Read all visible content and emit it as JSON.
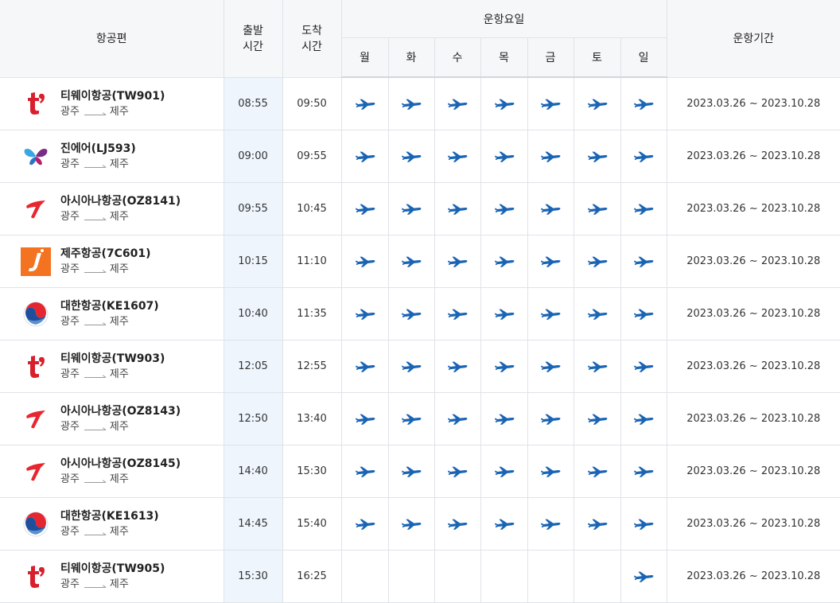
{
  "header": {
    "flight": "항공편",
    "depart_line1": "출발",
    "depart_line2": "시간",
    "arrive_line1": "도착",
    "arrive_line2": "시간",
    "days_group": "운항요일",
    "days": [
      "월",
      "화",
      "수",
      "목",
      "금",
      "토",
      "일"
    ],
    "period": "운항기간"
  },
  "colors": {
    "plane": "#1a64b4",
    "dep_col_bg": "#eef5fd"
  },
  "rows": [
    {
      "airline": "tway",
      "logo_icon": "tway-logo-icon",
      "name": "티웨이항공(TW901)",
      "from": "광주",
      "to": "제주",
      "dep": "08:55",
      "arr": "09:50",
      "days": [
        true,
        true,
        true,
        true,
        true,
        true,
        true
      ],
      "period": "2023.03.26 ~ 2023.10.28"
    },
    {
      "airline": "jinair",
      "logo_icon": "jinair-logo-icon",
      "name": "진에어(LJ593)",
      "from": "광주",
      "to": "제주",
      "dep": "09:00",
      "arr": "09:55",
      "days": [
        true,
        true,
        true,
        true,
        true,
        true,
        true
      ],
      "period": "2023.03.26 ~ 2023.10.28"
    },
    {
      "airline": "asiana",
      "logo_icon": "asiana-logo-icon",
      "name": "아시아나항공(OZ8141)",
      "from": "광주",
      "to": "제주",
      "dep": "09:55",
      "arr": "10:45",
      "days": [
        true,
        true,
        true,
        true,
        true,
        true,
        true
      ],
      "period": "2023.03.26 ~ 2023.10.28"
    },
    {
      "airline": "jeju",
      "logo_icon": "jejuair-logo-icon",
      "name": "제주항공(7C601)",
      "from": "광주",
      "to": "제주",
      "dep": "10:15",
      "arr": "11:10",
      "days": [
        true,
        true,
        true,
        true,
        true,
        true,
        true
      ],
      "period": "2023.03.26 ~ 2023.10.28"
    },
    {
      "airline": "korean",
      "logo_icon": "koreanair-logo-icon",
      "name": "대한항공(KE1607)",
      "from": "광주",
      "to": "제주",
      "dep": "10:40",
      "arr": "11:35",
      "days": [
        true,
        true,
        true,
        true,
        true,
        true,
        true
      ],
      "period": "2023.03.26 ~ 2023.10.28"
    },
    {
      "airline": "tway",
      "logo_icon": "tway-logo-icon",
      "name": "티웨이항공(TW903)",
      "from": "광주",
      "to": "제주",
      "dep": "12:05",
      "arr": "12:55",
      "days": [
        true,
        true,
        true,
        true,
        true,
        true,
        true
      ],
      "period": "2023.03.26 ~ 2023.10.28"
    },
    {
      "airline": "asiana",
      "logo_icon": "asiana-logo-icon",
      "name": "아시아나항공(OZ8143)",
      "from": "광주",
      "to": "제주",
      "dep": "12:50",
      "arr": "13:40",
      "days": [
        true,
        true,
        true,
        true,
        true,
        true,
        true
      ],
      "period": "2023.03.26 ~ 2023.10.28"
    },
    {
      "airline": "asiana",
      "logo_icon": "asiana-logo-icon",
      "name": "아시아나항공(OZ8145)",
      "from": "광주",
      "to": "제주",
      "dep": "14:40",
      "arr": "15:30",
      "days": [
        true,
        true,
        true,
        true,
        true,
        true,
        true
      ],
      "period": "2023.03.26 ~ 2023.10.28"
    },
    {
      "airline": "korean",
      "logo_icon": "koreanair-logo-icon",
      "name": "대한항공(KE1613)",
      "from": "광주",
      "to": "제주",
      "dep": "14:45",
      "arr": "15:40",
      "days": [
        true,
        true,
        true,
        true,
        true,
        true,
        true
      ],
      "period": "2023.03.26 ~ 2023.10.28"
    },
    {
      "airline": "tway",
      "logo_icon": "tway-logo-icon",
      "name": "티웨이항공(TW905)",
      "from": "광주",
      "to": "제주",
      "dep": "15:30",
      "arr": "16:25",
      "days": [
        false,
        false,
        false,
        false,
        false,
        false,
        true
      ],
      "period": "2023.03.26 ~ 2023.10.28"
    }
  ]
}
